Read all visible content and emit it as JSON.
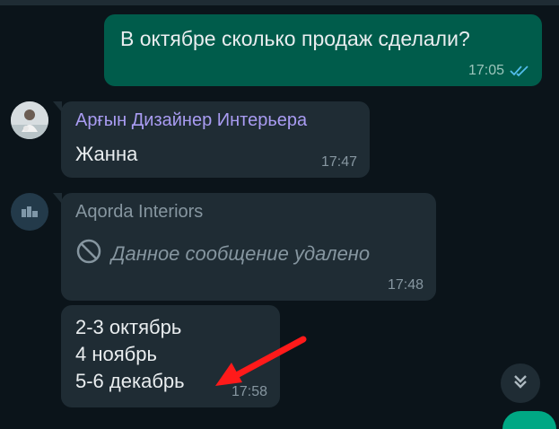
{
  "colors": {
    "background": "#0b141a",
    "outgoing_bubble": "#005c4b",
    "incoming_bubble": "#1f2c34",
    "sender_name_1": "#a99cf2",
    "sender_name_2": "#8696a0",
    "read_ticks": "#53bdeb",
    "annotation_arrow": "#ff1a1a"
  },
  "messages": [
    {
      "direction": "outgoing",
      "text": "В октябре сколько продаж сделали?",
      "time": "17:05",
      "status_icon": "double-check-read-icon"
    },
    {
      "direction": "incoming",
      "sender": "Арғын Дизайнер Интерьера",
      "text": "Жанна",
      "time": "17:47",
      "avatar": "user-photo-avatar"
    },
    {
      "direction": "incoming",
      "sender": "Aqorda Interiors",
      "text": "Данное сообщение удалено",
      "deleted": true,
      "deleted_icon": "block-icon",
      "time": "17:48",
      "avatar": "business-avatar"
    },
    {
      "direction": "incoming",
      "lines": [
        "2-3 октябрь",
        "4 ноябрь",
        "5-6 декабрь"
      ],
      "time": "17:58"
    }
  ],
  "scroll_button_icon": "double-chevron-down-icon",
  "annotation": "red-arrow-icon"
}
